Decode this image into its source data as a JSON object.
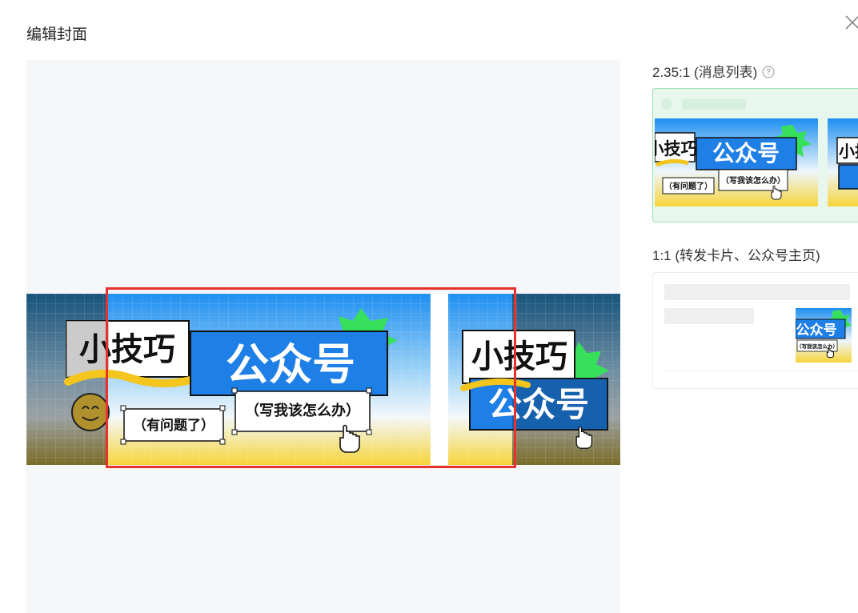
{
  "dialog": {
    "title": "编辑封面",
    "close_icon": "close-icon"
  },
  "cover": {
    "tag": "小技巧",
    "headline": "公众号",
    "sub_left": "（有问题了）",
    "sub_right": "（写我该怎么办）",
    "crop_color": "#e8302c"
  },
  "sidebar": {
    "ratio_235_label": "2.35:1 (消息列表)",
    "ratio_11_label": "1:1 (转发卡片、公众号主页)",
    "help_icon": "help-circle-icon"
  },
  "colors": {
    "sky_blue": "#1e8ff0",
    "yellow": "#f6d43a",
    "green_burst": "#37e05a",
    "accent_green_border": "#9be0b3"
  }
}
